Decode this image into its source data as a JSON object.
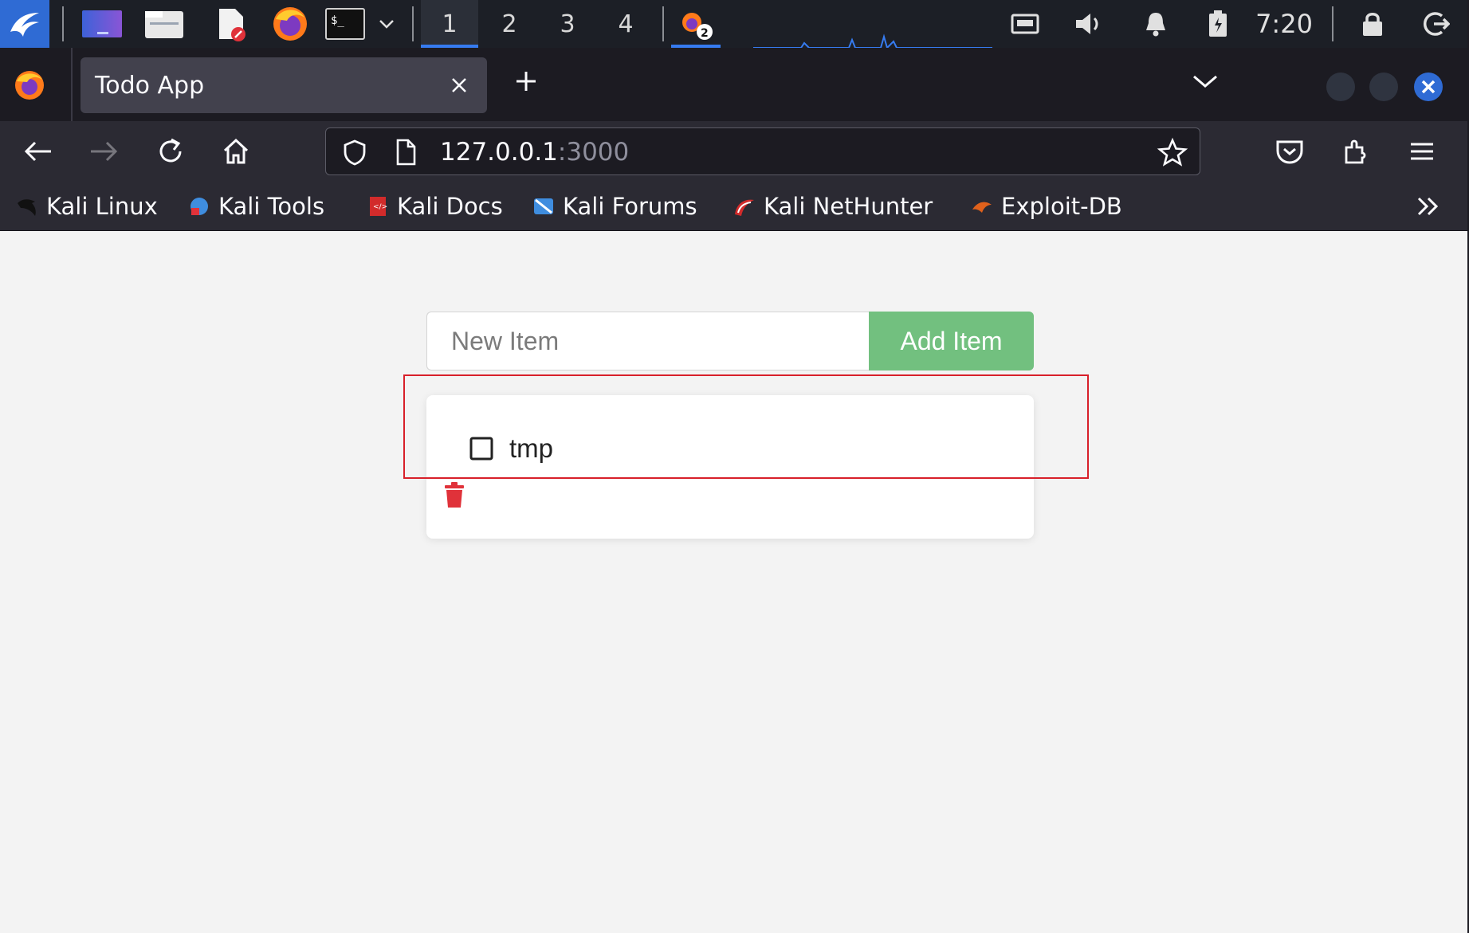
{
  "taskbar": {
    "workspaces": [
      "1",
      "2",
      "3",
      "4"
    ],
    "active_workspace": "1",
    "clock": "7:20",
    "icons": [
      "kali-menu-icon",
      "desktop-icon",
      "file-manager-icon",
      "text-editor-icon",
      "firefox-icon",
      "terminal-icon",
      "chevron-down-icon",
      "active-window-icon",
      "network-icon",
      "volume-icon",
      "bell-icon",
      "battery-icon",
      "lock-icon",
      "logout-icon"
    ]
  },
  "browser": {
    "tab": {
      "title": "Todo App"
    },
    "url": {
      "host": "127.0.0.1",
      "port": ":3000"
    },
    "bookmarks": [
      {
        "label": "Kali Linux",
        "icon": "kali-dragon-icon",
        "color": "#111111"
      },
      {
        "label": "Kali Tools",
        "icon": "kali-tools-icon",
        "color": "#3f8ddf"
      },
      {
        "label": "Kali Docs",
        "icon": "kali-docs-icon",
        "color": "#d22b2b"
      },
      {
        "label": "Kali Forums",
        "icon": "kali-forums-icon",
        "color": "#3f8ddf"
      },
      {
        "label": "Kali NetHunter",
        "icon": "kali-nethunter-icon",
        "color": "#d22b2b"
      },
      {
        "label": "Exploit-DB",
        "icon": "exploit-db-icon",
        "color": "#e0611c"
      }
    ]
  },
  "todo": {
    "input_placeholder": "New Item",
    "add_button_label": "Add Item",
    "items": [
      {
        "label": "tmp",
        "completed": false
      }
    ]
  },
  "colors": {
    "accent_blue": "#367bf0",
    "add_button": "#72c07f",
    "trash": "#e0323a",
    "highlight": "#d8202a"
  }
}
